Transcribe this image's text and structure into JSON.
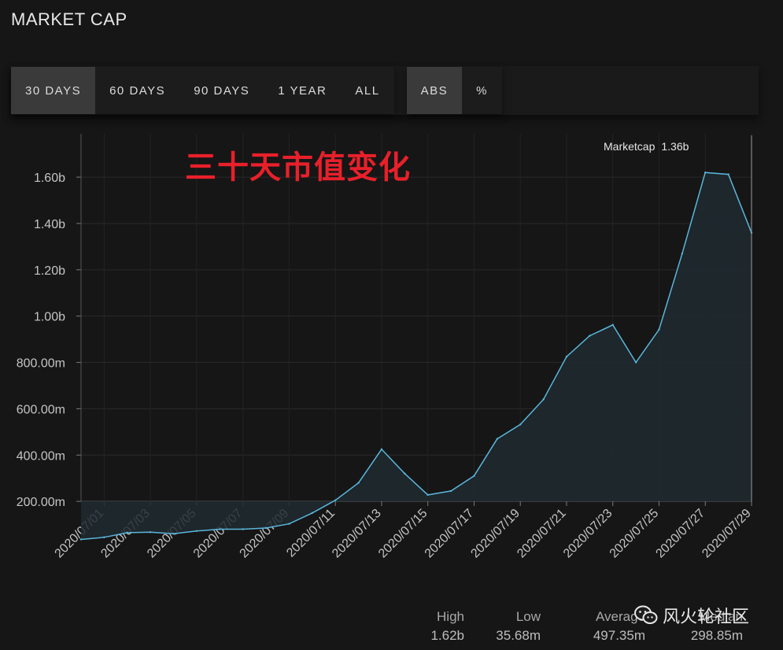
{
  "header": {
    "title": "MARKET CAP"
  },
  "range_buttons": [
    {
      "label": "30 DAYS",
      "active": true
    },
    {
      "label": "60 DAYS",
      "active": false
    },
    {
      "label": "90 DAYS",
      "active": false
    },
    {
      "label": "1 YEAR",
      "active": false
    },
    {
      "label": "ALL",
      "active": false
    }
  ],
  "mode_buttons": [
    {
      "label": "ABS",
      "active": true
    },
    {
      "label": "%",
      "active": false
    }
  ],
  "annotation": "三十天市值变化",
  "tooltip": {
    "label": "Marketcap",
    "value": "1.36b"
  },
  "stats": [
    {
      "label": "High",
      "value": "1.62b"
    },
    {
      "label": "Low",
      "value": "35.68m"
    },
    {
      "label": "Average",
      "value": "497.35m"
    },
    {
      "label": "Median",
      "value": "298.85m"
    }
  ],
  "watermark": {
    "text": "风火轮社区",
    "icon": "wechat-icon"
  },
  "colors": {
    "line": "#5bb6dc",
    "accent_text": "#e8202a",
    "background": "#161616"
  },
  "chart_data": {
    "type": "area",
    "series": [
      {
        "name": "Marketcap",
        "x": [
          "2020/06/30",
          "2020/07/01",
          "2020/07/02",
          "2020/07/03",
          "2020/07/04",
          "2020/07/05",
          "2020/07/06",
          "2020/07/07",
          "2020/07/08",
          "2020/07/09",
          "2020/07/10",
          "2020/07/11",
          "2020/07/12",
          "2020/07/13",
          "2020/07/14",
          "2020/07/15",
          "2020/07/16",
          "2020/07/17",
          "2020/07/18",
          "2020/07/19",
          "2020/07/20",
          "2020/07/21",
          "2020/07/22",
          "2020/07/23",
          "2020/07/24",
          "2020/07/25",
          "2020/07/26",
          "2020/07/27",
          "2020/07/28",
          "2020/07/29"
        ],
        "values": [
          35.68,
          45,
          65,
          67,
          60,
          72,
          80,
          80,
          85,
          103,
          150,
          205,
          280,
          425,
          320,
          228,
          245,
          310,
          470,
          532,
          640,
          825,
          915,
          962,
          800,
          942,
          1270,
          1620,
          1612,
          1360
        ]
      }
    ],
    "x_tick_labels": [
      "2020/07/01",
      "2020/07/03",
      "2020/07/05",
      "2020/07/07",
      "2020/07/09",
      "2020/07/11",
      "2020/07/13",
      "2020/07/15",
      "2020/07/17",
      "2020/07/19",
      "2020/07/21",
      "2020/07/23",
      "2020/07/25",
      "2020/07/27",
      "2020/07/29"
    ],
    "y_ticks": [
      200,
      400,
      600,
      800,
      1000,
      1200,
      1400,
      1600
    ],
    "y_tick_labels": [
      "200.00m",
      "400.00m",
      "600.00m",
      "800.00m",
      "1.00b",
      "1.20b",
      "1.40b",
      "1.60b"
    ],
    "ylim": [
      0,
      1620
    ],
    "grid": true,
    "legend": "none"
  }
}
